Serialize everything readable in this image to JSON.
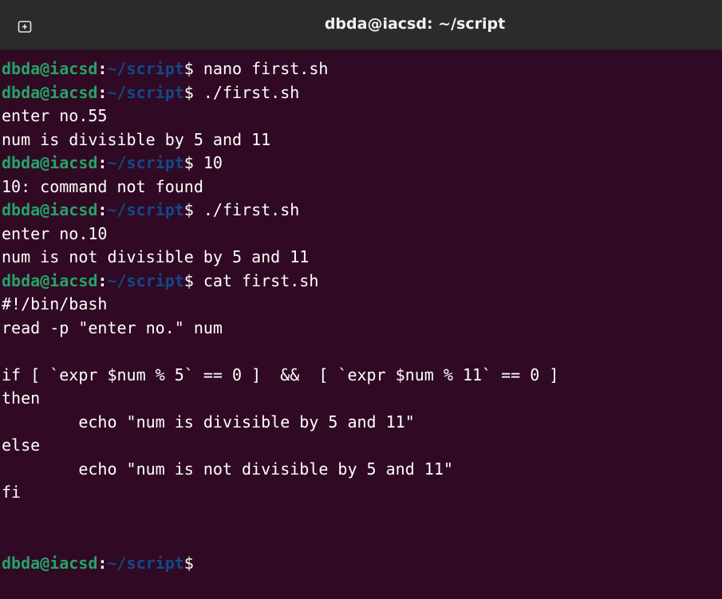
{
  "window": {
    "title": "dbda@iacsd: ~/script",
    "new_tab_icon": "new-tab-icon"
  },
  "colors": {
    "background": "#300a24",
    "titlebar": "#2b2b2b",
    "prompt_user": "#26a269",
    "prompt_path": "#12488b",
    "text": "#ffffff"
  },
  "terminal": {
    "lines": [
      {
        "type": "prompt",
        "user": "dbda@iacsd",
        "sep": ":",
        "path": "~/script",
        "dollar": "$",
        "cmd": " nano first.sh"
      },
      {
        "type": "prompt",
        "user": "dbda@iacsd",
        "sep": ":",
        "path": "~/script",
        "dollar": "$",
        "cmd": " ./first.sh"
      },
      {
        "type": "output",
        "text": "enter no.55"
      },
      {
        "type": "output",
        "text": "num is divisible by 5 and 11"
      },
      {
        "type": "prompt",
        "user": "dbda@iacsd",
        "sep": ":",
        "path": "~/script",
        "dollar": "$",
        "cmd": " 10"
      },
      {
        "type": "output",
        "text": "10: command not found"
      },
      {
        "type": "prompt",
        "user": "dbda@iacsd",
        "sep": ":",
        "path": "~/script",
        "dollar": "$",
        "cmd": " ./first.sh"
      },
      {
        "type": "output",
        "text": "enter no.10"
      },
      {
        "type": "output",
        "text": "num is not divisible by 5 and 11"
      },
      {
        "type": "prompt",
        "user": "dbda@iacsd",
        "sep": ":",
        "path": "~/script",
        "dollar": "$",
        "cmd": " cat first.sh"
      },
      {
        "type": "output",
        "text": "#!/bin/bash"
      },
      {
        "type": "output",
        "text": "read -p \"enter no.\" num"
      },
      {
        "type": "output",
        "text": ""
      },
      {
        "type": "output",
        "text": "if [ `expr $num % 5` == 0 ]  &&  [ `expr $num % 11` == 0 ]"
      },
      {
        "type": "output",
        "text": "then"
      },
      {
        "type": "output",
        "text": "        echo \"num is divisible by 5 and 11\""
      },
      {
        "type": "output",
        "text": "else"
      },
      {
        "type": "output",
        "text": "        echo \"num is not divisible by 5 and 11\""
      },
      {
        "type": "output",
        "text": "fi"
      },
      {
        "type": "output",
        "text": ""
      },
      {
        "type": "output",
        "text": ""
      },
      {
        "type": "prompt",
        "user": "dbda@iacsd",
        "sep": ":",
        "path": "~/script",
        "dollar": "$",
        "cmd": ""
      }
    ]
  }
}
